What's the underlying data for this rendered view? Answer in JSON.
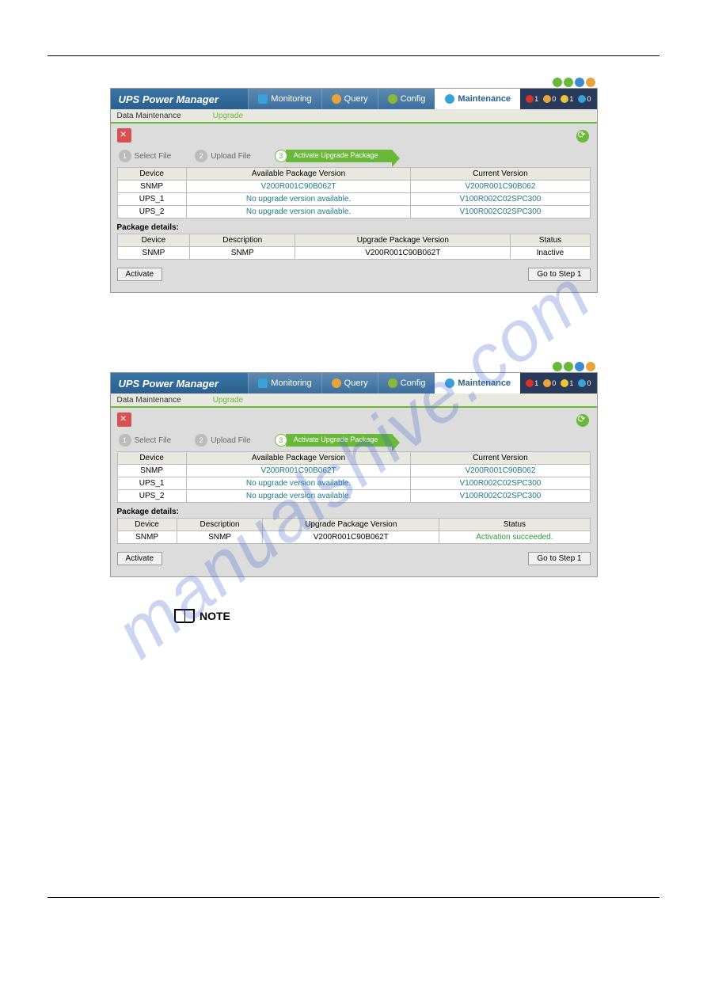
{
  "watermark": "manualshive.com",
  "note_label": "NOTE",
  "screenshots": [
    {
      "app_title": "UPS Power Manager",
      "tabs": [
        {
          "label": "Monitoring",
          "icon": "icon-monitor"
        },
        {
          "label": "Query",
          "icon": "icon-query"
        },
        {
          "label": "Config",
          "icon": "icon-config"
        },
        {
          "label": "Maintenance",
          "icon": "icon-maint",
          "active": true
        }
      ],
      "badges": [
        {
          "cls": "bi-red",
          "n": "1"
        },
        {
          "cls": "bi-yel",
          "n": "0"
        },
        {
          "cls": "bi-org",
          "n": "1"
        },
        {
          "cls": "bi-blu",
          "n": "0"
        }
      ],
      "subtabs": [
        {
          "label": "Data Maintenance"
        },
        {
          "label": "Upgrade",
          "active": true
        }
      ],
      "steps": [
        {
          "num": "1",
          "label": "Select File"
        },
        {
          "num": "2",
          "label": "Upload File"
        },
        {
          "num": "3",
          "label": "Activate Upgrade Package",
          "active": true
        }
      ],
      "tbl1": {
        "headers": [
          "Device",
          "Available Package Version",
          "Current Version"
        ],
        "rows": [
          [
            "SNMP",
            "V200R001C90B062T",
            "V200R001C90B062"
          ],
          [
            "UPS_1",
            "No upgrade version available.",
            "V100R002C02SPC300"
          ],
          [
            "UPS_2",
            "No upgrade version available.",
            "V100R002C02SPC300"
          ]
        ]
      },
      "pkg_label": "Package details:",
      "tbl2": {
        "headers": [
          "Device",
          "Description",
          "Upgrade Package Version",
          "Status"
        ],
        "rows": [
          [
            "SNMP",
            "SNMP",
            "V200R001C90B062T",
            "Inactive"
          ]
        ],
        "status_class": ""
      },
      "btn_left": "Activate",
      "btn_right": "Go to Step 1"
    },
    {
      "app_title": "UPS Power Manager",
      "tabs": [
        {
          "label": "Monitoring",
          "icon": "icon-monitor"
        },
        {
          "label": "Query",
          "icon": "icon-query"
        },
        {
          "label": "Config",
          "icon": "icon-config"
        },
        {
          "label": "Maintenance",
          "icon": "icon-maint",
          "active": true
        }
      ],
      "badges": [
        {
          "cls": "bi-red",
          "n": "1"
        },
        {
          "cls": "bi-yel",
          "n": "0"
        },
        {
          "cls": "bi-org",
          "n": "1"
        },
        {
          "cls": "bi-blu",
          "n": "0"
        }
      ],
      "subtabs": [
        {
          "label": "Data Maintenance"
        },
        {
          "label": "Upgrade",
          "active": true
        }
      ],
      "steps": [
        {
          "num": "1",
          "label": "Select File"
        },
        {
          "num": "2",
          "label": "Upload File"
        },
        {
          "num": "3",
          "label": "Activate Upgrade Package",
          "active": true
        }
      ],
      "tbl1": {
        "headers": [
          "Device",
          "Available Package Version",
          "Current Version"
        ],
        "rows": [
          [
            "SNMP",
            "V200R001C90B062T",
            "V200R001C90B062"
          ],
          [
            "UPS_1",
            "No upgrade version available.",
            "V100R002C02SPC300"
          ],
          [
            "UPS_2",
            "No upgrade version available.",
            "V100R002C02SPC300"
          ]
        ]
      },
      "pkg_label": "Package details:",
      "tbl2": {
        "headers": [
          "Device",
          "Description",
          "Upgrade Package Version",
          "Status"
        ],
        "rows": [
          [
            "SNMP",
            "SNMP",
            "V200R001C90B062T",
            "Activation succeeded."
          ]
        ],
        "status_class": "green"
      },
      "btn_left": "Activate",
      "btn_right": "Go to Step 1"
    }
  ]
}
